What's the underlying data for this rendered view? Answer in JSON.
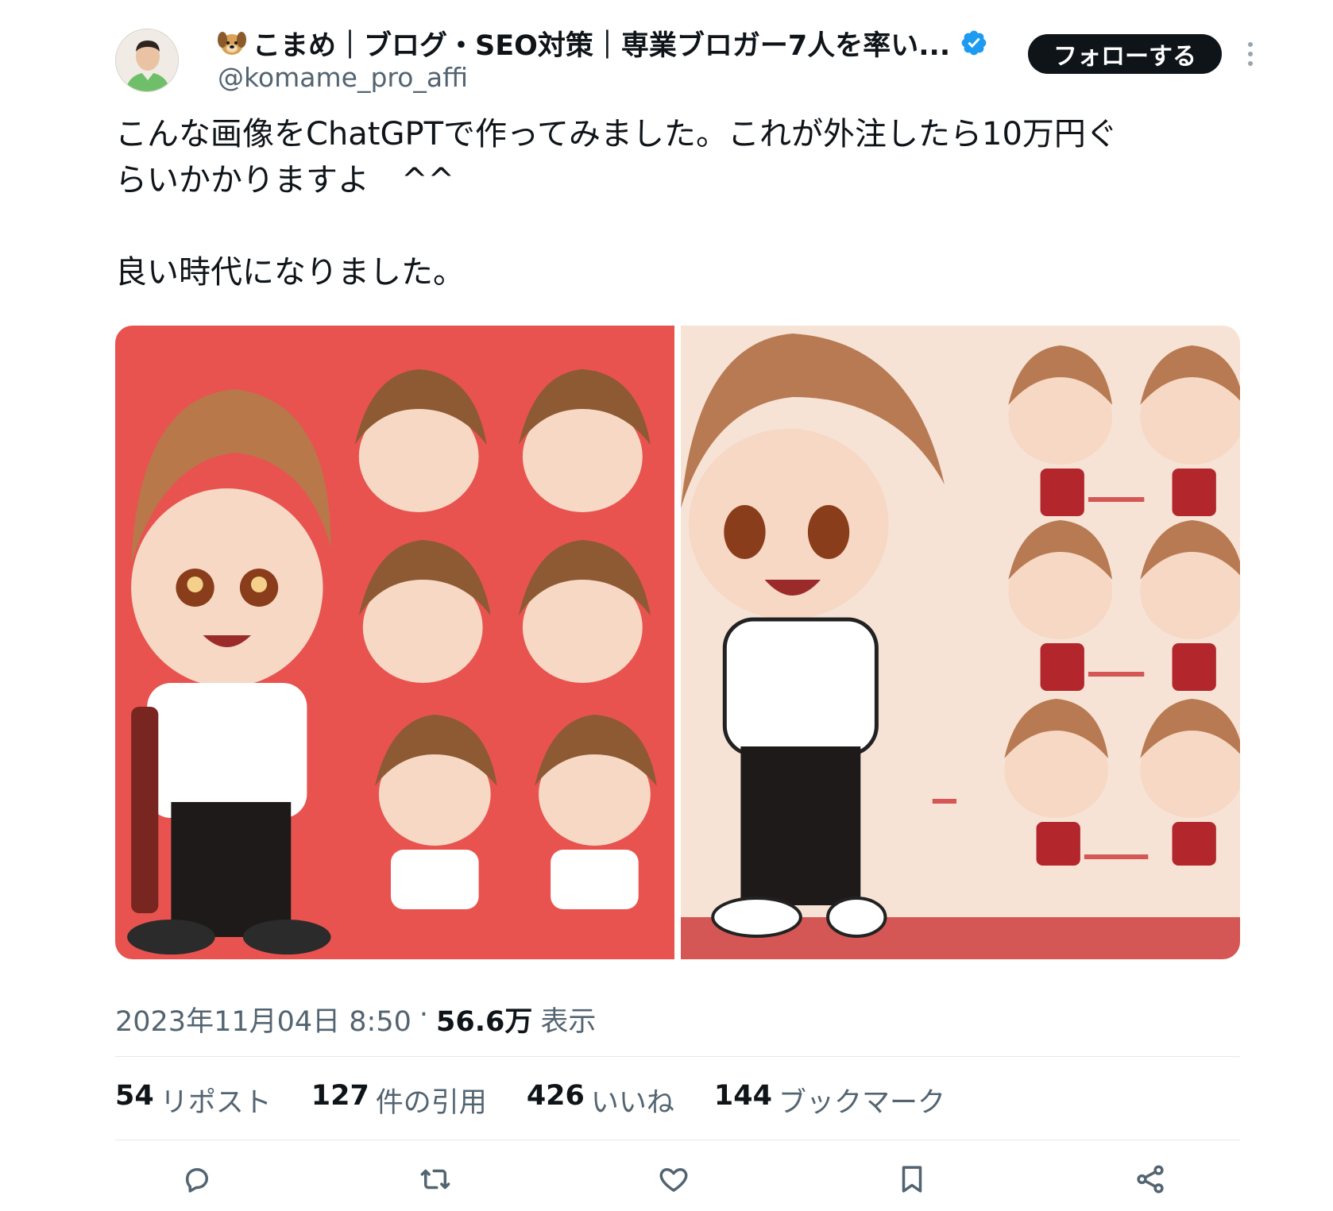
{
  "author": {
    "display_name": "こまめ｜ブログ・SEO対策｜専業ブロガー7人を率い...",
    "handle": "@komame_pro_affi",
    "emoji_icon": "dog-face-icon",
    "verified_icon": "verified-badge-icon",
    "verified_color": "#1d9bf0"
  },
  "header": {
    "follow_label": "フォローする",
    "more_icon": "more-vertical-icon"
  },
  "tweet": {
    "lines": [
      "こんな画像をChatGPTで作ってみました。これが外注したら10万円ぐ",
      "らいかかりますよ　^^",
      "良い時代になりました。"
    ]
  },
  "media": {
    "left_bg": "#e8534f",
    "right_bg": "#f6e3d6"
  },
  "meta": {
    "timestamp": "2023年11月04日 8:50",
    "separator": "·",
    "views_count": "56.6万",
    "views_label": "表示"
  },
  "stats": [
    {
      "num": "54",
      "label": "リポスト"
    },
    {
      "num": "127",
      "label": "件の引用"
    },
    {
      "num": "426",
      "label": "いいね"
    },
    {
      "num": "144",
      "label": "ブックマーク"
    }
  ],
  "actions": [
    "reply-icon",
    "repost-icon",
    "like-icon",
    "bookmark-icon",
    "share-icon"
  ]
}
